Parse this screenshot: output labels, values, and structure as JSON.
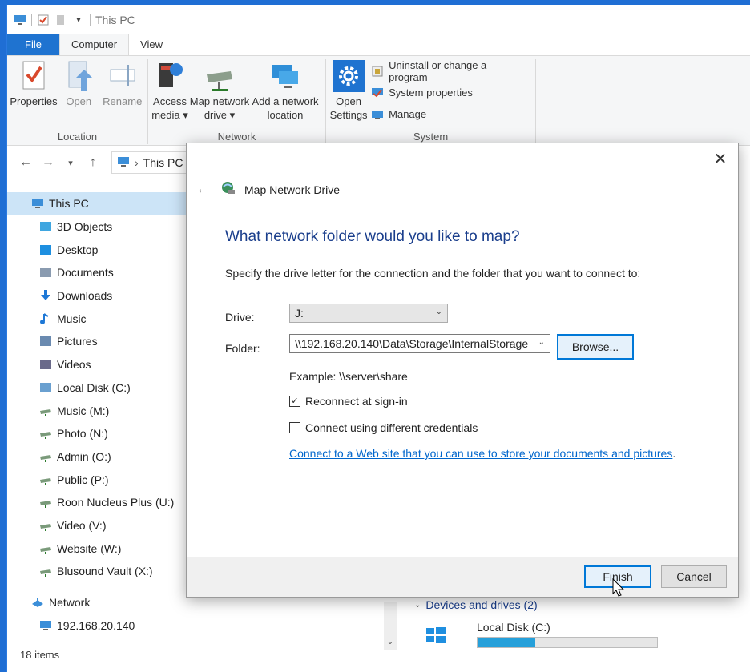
{
  "window": {
    "title": "This PC"
  },
  "tabs": [
    {
      "label": "File"
    },
    {
      "label": "Computer"
    },
    {
      "label": "View"
    }
  ],
  "ribbon": {
    "location": {
      "label": "Location",
      "properties": "Properties",
      "open": "Open",
      "rename": "Rename"
    },
    "network": {
      "label": "Network",
      "access_media_1": "Access",
      "access_media_2": "media ▾",
      "map_drive_1": "Map network",
      "map_drive_2": "drive ▾",
      "add_location_1": "Add a network",
      "add_location_2": "location"
    },
    "system": {
      "label": "System",
      "open_settings_1": "Open",
      "open_settings_2": "Settings",
      "uninstall": "Uninstall or change a program",
      "system_properties": "System properties",
      "manage": "Manage"
    }
  },
  "addressbar": {
    "path": "This PC"
  },
  "nav": {
    "this_pc": "This PC",
    "items": [
      {
        "label": "3D Objects",
        "icon": "3d-objects-icon",
        "color": "#3fa6e0"
      },
      {
        "label": "Desktop",
        "icon": "desktop-icon",
        "color": "#1e8fe0"
      },
      {
        "label": "Documents",
        "icon": "documents-icon",
        "color": "#8a9bb0"
      },
      {
        "label": "Downloads",
        "icon": "downloads-icon",
        "color": "#1e78d6"
      },
      {
        "label": "Music",
        "icon": "music-icon",
        "color": "#1e78d6"
      },
      {
        "label": "Pictures",
        "icon": "pictures-icon",
        "color": "#6a8ab0"
      },
      {
        "label": "Videos",
        "icon": "videos-icon",
        "color": "#6a6a8a"
      },
      {
        "label": "Local Disk (C:)",
        "icon": "local-disk-icon",
        "color": "#6aa0d0"
      },
      {
        "label": "Music (M:)",
        "icon": "network-drive-icon",
        "color": "#7a9a7a"
      },
      {
        "label": "Photo (N:)",
        "icon": "network-drive-icon",
        "color": "#7a9a7a"
      },
      {
        "label": "Admin (O:)",
        "icon": "network-drive-icon",
        "color": "#7a9a7a"
      },
      {
        "label": "Public (P:)",
        "icon": "network-drive-icon",
        "color": "#7a9a7a"
      },
      {
        "label": "Roon Nucleus Plus (U:)",
        "icon": "network-drive-icon",
        "color": "#7a9a7a"
      },
      {
        "label": "Video (V:)",
        "icon": "network-drive-icon",
        "color": "#7a9a7a"
      },
      {
        "label": "Website (W:)",
        "icon": "network-drive-icon",
        "color": "#7a9a7a"
      },
      {
        "label": "Blusound Vault (X:)",
        "icon": "network-drive-icon",
        "color": "#7a9a7a"
      }
    ],
    "network": "Network",
    "network_host": "192.168.20.140"
  },
  "status": {
    "items": "18 items"
  },
  "content": {
    "section": "Devices and drives (2)",
    "drive_label": "Local Disk (C:)",
    "drive_usage": 0.32
  },
  "dialog": {
    "title": "Map Network Drive",
    "heading": "What network folder would you like to map?",
    "subtitle": "Specify the drive letter for the connection and the folder that you want to connect to:",
    "drive_label": "Drive:",
    "drive_value": "J:",
    "folder_label": "Folder:",
    "folder_value": "\\\\192.168.20.140\\Data\\Storage\\InternalStorage",
    "browse": "Browse...",
    "example": "Example: \\\\server\\share",
    "reconnect": "Reconnect at sign-in",
    "reconnect_checked": true,
    "different_credentials": "Connect using different credentials",
    "different_credentials_checked": false,
    "web_link": "Connect to a Web site that you can use to store your documents and pictures",
    "finish": "Finish",
    "cancel": "Cancel"
  },
  "colors": {
    "accent": "#1f73d0",
    "heading": "#1a3e8c",
    "link": "#0066cc",
    "selection": "#cce4f7"
  }
}
